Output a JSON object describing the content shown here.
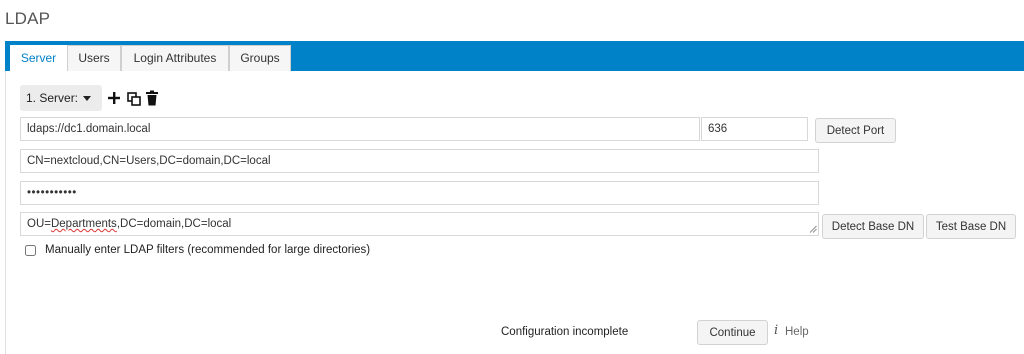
{
  "page": {
    "title": "LDAP"
  },
  "tabs": [
    {
      "label": "Server",
      "active": true
    },
    {
      "label": "Users",
      "active": false
    },
    {
      "label": "Login Attributes",
      "active": false
    },
    {
      "label": "Groups",
      "active": false
    }
  ],
  "server": {
    "select_label": "1. Server:",
    "icons": {
      "add": "plus-icon",
      "copy": "copy-icon",
      "delete": "trash-icon"
    },
    "host": "ldaps://dc1.domain.local",
    "port": "636",
    "detect_port_label": "Detect Port",
    "user_dn": "CN=nextcloud,CN=Users,DC=domain,DC=local",
    "password_mask": "•••••••••••",
    "base_dn_prefix": "OU=",
    "base_dn_misspelled": "Departments",
    "base_dn_suffix": ",DC=domain,DC=local",
    "detect_base_dn_label": "Detect Base DN",
    "test_base_dn_label": "Test Base DN",
    "manual_filters_label": "Manually enter LDAP filters (recommended for large directories)",
    "manual_filters_checked": false
  },
  "footer": {
    "status": "Configuration incomplete",
    "continue_label": "Continue",
    "help_icon": "i",
    "help_label": "Help"
  },
  "colors": {
    "accent": "#0082c9",
    "tab_bg": "#f6f6f6"
  }
}
